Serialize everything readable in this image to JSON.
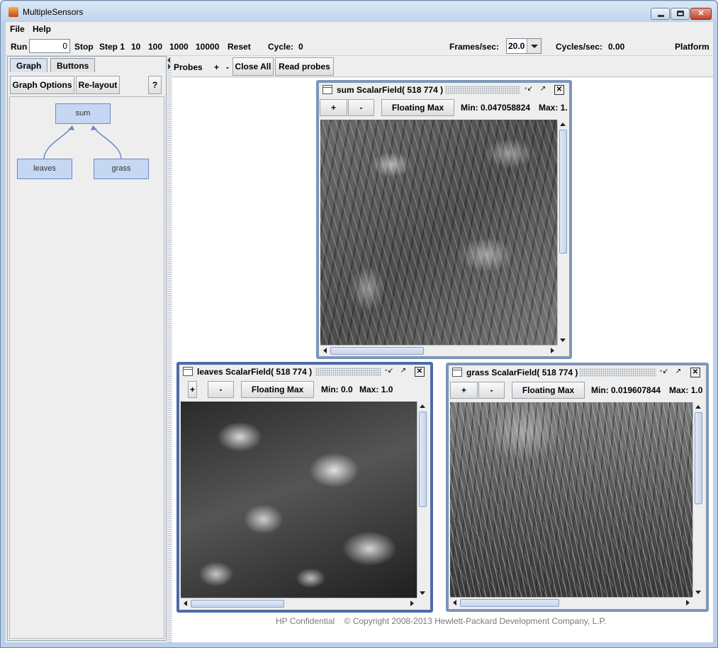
{
  "window": {
    "title": "MultipleSensors"
  },
  "menu": {
    "file": "File",
    "help": "Help"
  },
  "toolbar": {
    "run_label": "Run",
    "run_value": "0",
    "stop": "Stop",
    "step1": "Step 1",
    "step10": "10",
    "step100": "100",
    "step1000": "1000",
    "step10000": "10000",
    "reset": "Reset",
    "cycle_label": "Cycle:",
    "cycle_value": "0",
    "fps_label": "Frames/sec:",
    "fps_value": "20.0",
    "cps_label": "Cycles/sec:",
    "cps_value": "0.00",
    "platform": "Platform"
  },
  "left_panel": {
    "tabs": [
      "Graph",
      "Buttons"
    ],
    "graph_options": "Graph Options",
    "relayout": "Re-layout",
    "help": "?",
    "nodes": {
      "sum": "sum",
      "leaves": "leaves",
      "grass": "grass"
    }
  },
  "probes_bar": {
    "label": "Probes",
    "plus": "+",
    "minus": "-",
    "close_all": "Close All",
    "read_probes": "Read probes"
  },
  "probe_windows": [
    {
      "title": "sum ScalarField( 518 774 )",
      "plus": "+",
      "minus": "-",
      "floating_max": "Floating Max",
      "min_label": "Min:",
      "min_value": "0.047058824",
      "max_label": "Max:",
      "max_value": "1."
    },
    {
      "title": "leaves ScalarField( 518 774 )",
      "plus": "+",
      "minus": "-",
      "floating_max": "Floating Max",
      "min_label": "Min:",
      "min_value": "0.0",
      "max_label": "Max:",
      "max_value": "1.0"
    },
    {
      "title": "grass ScalarField( 518 774 )",
      "plus": "+",
      "minus": "-",
      "floating_max": "Floating Max",
      "min_label": "Min:",
      "min_value": "0.019607844",
      "max_label": "Max:",
      "max_value": "1.0"
    }
  ],
  "footer": {
    "confidential": "HP Confidential",
    "copyright": "© Copyright 2008-2013 Hewlett-Packard Development Company, L.P."
  },
  "icons": {
    "app": "java-cup-icon",
    "probe_window": "window-icon",
    "minimize": "minimize-icon",
    "maximize": "maximize-icon",
    "close": "close-icon"
  },
  "colors": {
    "graph_node_fill": "#c5d7f3",
    "graph_node_border": "#6d89c4",
    "probe_border": "#7d96b8",
    "probe_border_selected": "#4a6da6"
  }
}
